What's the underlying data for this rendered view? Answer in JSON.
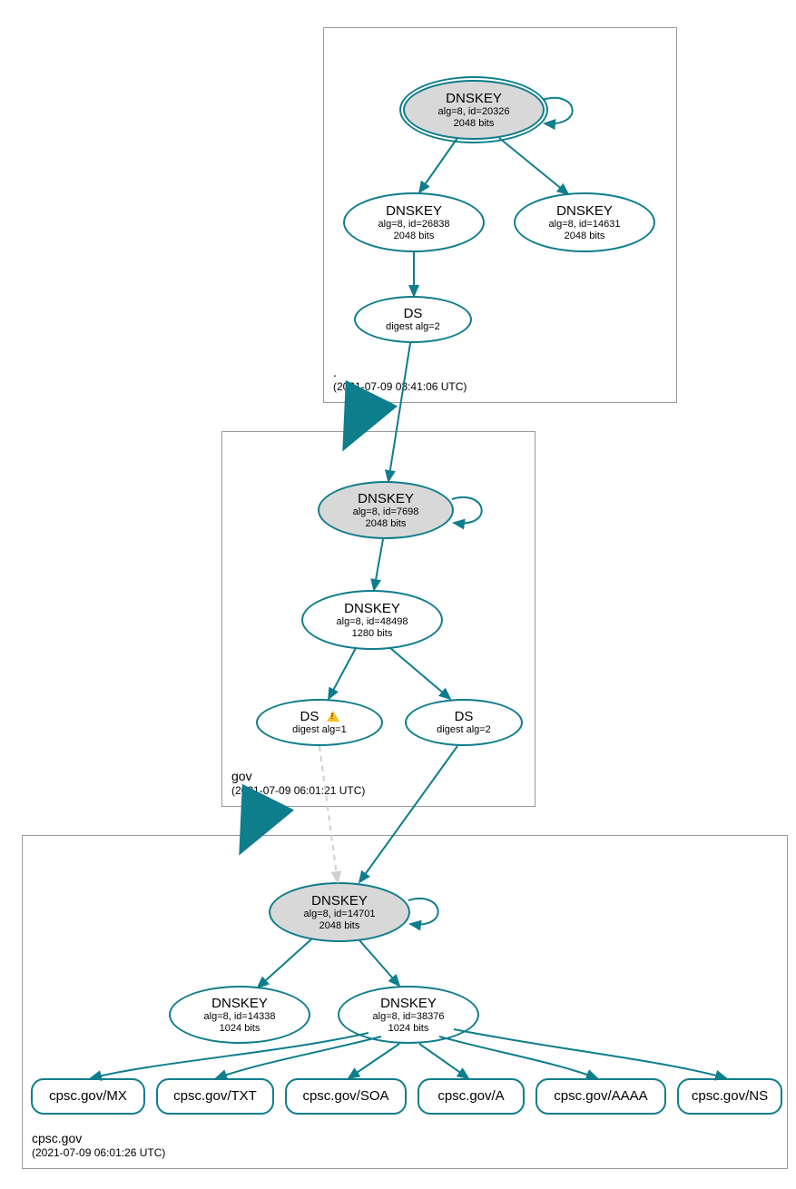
{
  "zones": {
    "root": {
      "name": ".",
      "timestamp": "(2021-07-09 03:41:06 UTC)"
    },
    "gov": {
      "name": "gov",
      "timestamp": "(2021-07-09 06:01:21 UTC)"
    },
    "cpsc": {
      "name": "cpsc.gov",
      "timestamp": "(2021-07-09 06:01:26 UTC)"
    }
  },
  "nodes": {
    "root_ksk": {
      "title": "DNSKEY",
      "line2": "alg=8, id=20326",
      "line3": "2048 bits"
    },
    "root_zsk1": {
      "title": "DNSKEY",
      "line2": "alg=8, id=26838",
      "line3": "2048 bits"
    },
    "root_zsk2": {
      "title": "DNSKEY",
      "line2": "alg=8, id=14631",
      "line3": "2048 bits"
    },
    "root_ds": {
      "title": "DS",
      "line2": "digest alg=2"
    },
    "gov_ksk": {
      "title": "DNSKEY",
      "line2": "alg=8, id=7698",
      "line3": "2048 bits"
    },
    "gov_zsk": {
      "title": "DNSKEY",
      "line2": "alg=8, id=48498",
      "line3": "1280 bits"
    },
    "gov_ds1": {
      "title": "DS",
      "line2": "digest alg=1"
    },
    "gov_ds2": {
      "title": "DS",
      "line2": "digest alg=2"
    },
    "cpsc_ksk": {
      "title": "DNSKEY",
      "line2": "alg=8, id=14701",
      "line3": "2048 bits"
    },
    "cpsc_zsk1": {
      "title": "DNSKEY",
      "line2": "alg=8, id=14338",
      "line3": "1024 bits"
    },
    "cpsc_zsk2": {
      "title": "DNSKEY",
      "line2": "alg=8, id=38376",
      "line3": "1024 bits"
    },
    "rr_mx": {
      "label": "cpsc.gov/MX"
    },
    "rr_txt": {
      "label": "cpsc.gov/TXT"
    },
    "rr_soa": {
      "label": "cpsc.gov/SOA"
    },
    "rr_a": {
      "label": "cpsc.gov/A"
    },
    "rr_aaaa": {
      "label": "cpsc.gov/AAAA"
    },
    "rr_ns": {
      "label": "cpsc.gov/NS"
    }
  },
  "colors": {
    "stroke": "#0e7d8c",
    "dashed": "#cfcfcf"
  }
}
